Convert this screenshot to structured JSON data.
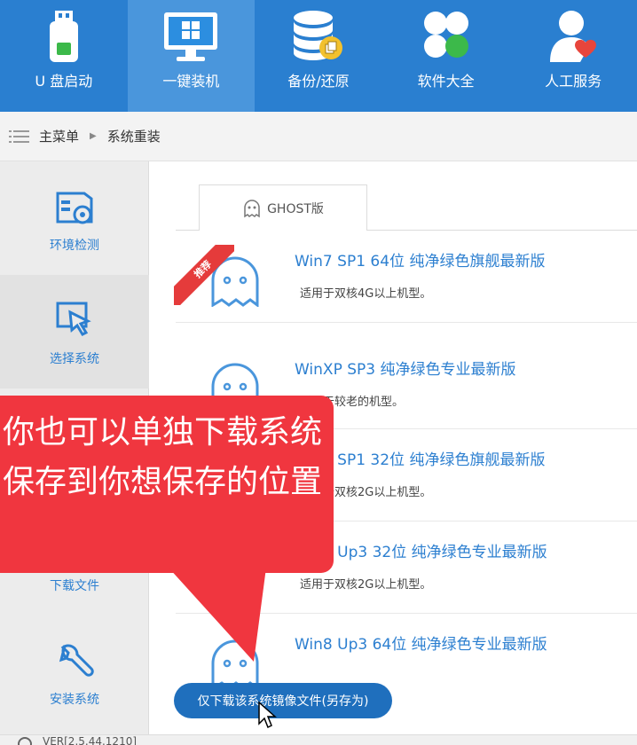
{
  "nav": {
    "items": [
      {
        "label": "U 盘启动",
        "icon": "usb-drive-icon"
      },
      {
        "label": "一键装机",
        "icon": "monitor-windows-icon",
        "active": true
      },
      {
        "label": "备份/还原",
        "icon": "database-backup-icon"
      },
      {
        "label": "软件大全",
        "icon": "apps-grid-icon"
      },
      {
        "label": "人工服务",
        "icon": "user-heart-icon"
      }
    ]
  },
  "breadcrumb": {
    "home": "主菜单",
    "current": "系统重装"
  },
  "sidebar": {
    "items": [
      {
        "label": "环境检测",
        "icon": "hardware-gear-icon"
      },
      {
        "label": "选择系统",
        "icon": "cursor-window-icon",
        "active": true
      },
      {
        "label": "下载文件",
        "icon": "download-icon"
      },
      {
        "label": "安装系统",
        "icon": "wrench-icon"
      }
    ]
  },
  "tab": {
    "label": "GHOST版"
  },
  "ribbon": "推荐",
  "systems": [
    {
      "title": "Win7 SP1 64位 纯净绿色旗舰最新版",
      "desc": "适用于双核4G以上机型。"
    },
    {
      "title": "WinXP SP3 纯净绿色专业最新版",
      "desc": "适用于较老的机型。"
    },
    {
      "title": "Win7 SP1 32位 纯净绿色旗舰最新版",
      "desc": "适用于双核2G以上机型。"
    },
    {
      "title": "Win8 Up3 32位 纯净绿色专业最新版",
      "desc": "适用于双核2G以上机型。"
    },
    {
      "title": "Win8 Up3 64位 纯净绿色专业最新版",
      "desc": ""
    }
  ],
  "download_button": "仅下载该系统镜像文件(另存为)",
  "footer": {
    "version": "VER[2.5.44.1210]"
  },
  "callout": {
    "text": "你也可以单独下载系统保存到你想保存的位置"
  },
  "colors": {
    "nav_bg": "#2a7fd0",
    "accent": "#2c7fd0",
    "callout": "#f0363f",
    "button": "#1f6fbd"
  }
}
